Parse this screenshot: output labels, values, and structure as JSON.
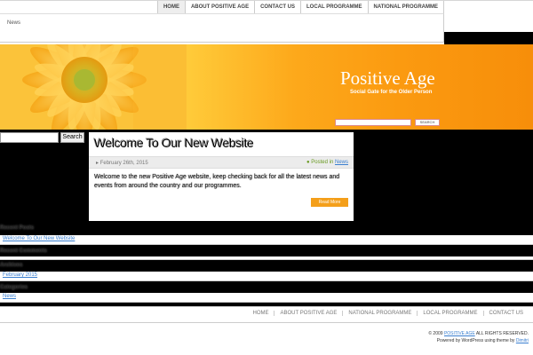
{
  "top_nav": [
    "HOME",
    "ABOUT POSITIVE AGE",
    "CONTACT US",
    "LOCAL PROGRAMME",
    "NATIONAL PROGRAMME"
  ],
  "sub_nav": {
    "item": "News"
  },
  "header": {
    "site_title": "Positive Age",
    "tagline": "Social Gate for the Older Person",
    "search_button": "SEARCH"
  },
  "sidebar": {
    "search_button": "Search",
    "widgets": [
      {
        "heading": "Recent Posts",
        "link": "Welcome To Our New Website"
      },
      {
        "heading": "Recent Comments",
        "link": ""
      },
      {
        "heading": "Archives",
        "link": "February 2015"
      },
      {
        "heading": "Categories",
        "link": "News"
      }
    ]
  },
  "post": {
    "title": "Welcome To Our New Website",
    "date": "February 26th, 2015",
    "posted_in_label": "Posted in",
    "category": "News",
    "excerpt": "Welcome to the new Positive Age website, keep checking back for all the latest news and events from around the country and our programmes.",
    "read_more": "Read More"
  },
  "footer": {
    "nav": [
      "HOME",
      "ABOUT POSITIVE AGE",
      "NATIONAL PROGRAMME",
      "LOCAL PROGRAMME",
      "CONTACT US"
    ],
    "copyright_prefix": "© 2009",
    "copyright_link": "POSITIVE AGE",
    "copyright_suffix": "ALL RIGHTS RESERVED.",
    "powered_by": "Powered by WordPress using theme by",
    "theme_author": "Dimitri"
  },
  "colors": {
    "banner_orange": "#f78e0a",
    "link_blue": "#3a7fd0",
    "posted_green": "#6a9a22",
    "read_more_orange": "#f49f1a"
  }
}
